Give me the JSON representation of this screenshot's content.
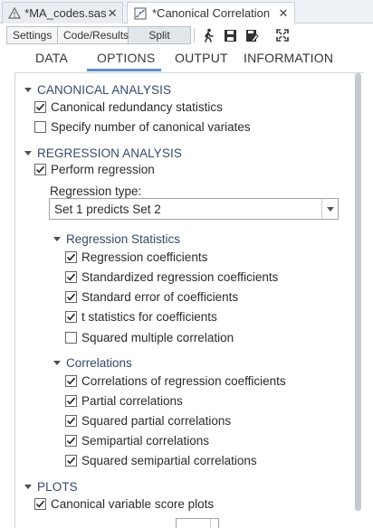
{
  "tabs": [
    {
      "label": "*MA_codes.sas",
      "icon": "warning-icon",
      "active": false
    },
    {
      "label": "*Canonical Correlation",
      "icon": "task-icon",
      "active": true
    }
  ],
  "toolbar": {
    "segments": [
      "Settings",
      "Code/Results",
      "Split"
    ],
    "buttons": [
      "run-icon",
      "save-icon",
      "save-as-icon",
      "maximize-icon"
    ]
  },
  "option_tabs": [
    "DATA",
    "OPTIONS",
    "OUTPUT",
    "INFORMATION"
  ],
  "selected_tab": "OPTIONS",
  "sections": {
    "canonical": {
      "title": "CANONICAL ANALYSIS",
      "items": [
        {
          "label": "Canonical redundancy statistics",
          "checked": true
        },
        {
          "label": "Specify number of canonical variates",
          "checked": false
        }
      ]
    },
    "regression": {
      "title": "REGRESSION ANALYSIS",
      "perform": {
        "label": "Perform regression",
        "checked": true
      },
      "type_label": "Regression type:",
      "type_value": "Set 1 predicts Set 2",
      "stats": {
        "title": "Regression Statistics",
        "items": [
          {
            "label": "Regression coefficients",
            "checked": true
          },
          {
            "label": "Standardized regression coefficients",
            "checked": true
          },
          {
            "label": "Standard error of coefficients",
            "checked": true
          },
          {
            "label": "t statistics for coefficients",
            "checked": true
          },
          {
            "label": "Squared multiple correlation",
            "checked": false
          }
        ]
      },
      "correlations": {
        "title": "Correlations",
        "items": [
          {
            "label": "Correlations of regression coefficients",
            "checked": true
          },
          {
            "label": "Partial correlations",
            "checked": true
          },
          {
            "label": "Squared partial correlations",
            "checked": true
          },
          {
            "label": "Semipartial correlations",
            "checked": true
          },
          {
            "label": "Squared semipartial correlations",
            "checked": true
          }
        ]
      }
    },
    "plots": {
      "title": "PLOTS",
      "items": [
        {
          "label": "Canonical variable score plots",
          "checked": true
        }
      ]
    }
  }
}
